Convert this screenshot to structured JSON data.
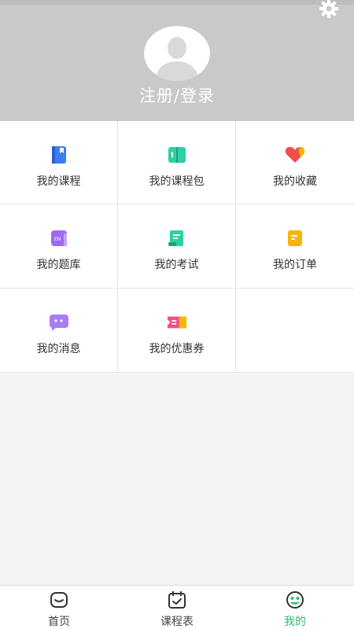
{
  "header": {
    "login_label": "注册/登录",
    "settings_icon": "gear-icon",
    "avatar_icon": "default-avatar-icon"
  },
  "menu": [
    {
      "label": "我的课程",
      "icon": "course-book-icon",
      "color": "#3d7cf5"
    },
    {
      "label": "我的课程包",
      "icon": "course-package-icon",
      "color": "#2ad1a3"
    },
    {
      "label": "我的收藏",
      "icon": "heart-favorite-icon",
      "color": "#f04d4d"
    },
    {
      "label": "我的题库",
      "icon": "question-bank-icon",
      "color": "#9b6cf0"
    },
    {
      "label": "我的考试",
      "icon": "exam-scroll-icon",
      "color": "#2ad1a3"
    },
    {
      "label": "我的订单",
      "icon": "order-note-icon",
      "color": "#f7b500"
    },
    {
      "label": "我的消息",
      "icon": "message-bubble-icon",
      "color": "#a77cf5"
    },
    {
      "label": "我的优惠券",
      "icon": "coupon-ticket-icon",
      "color": "#f0508a"
    }
  ],
  "tabbar": {
    "tabs": [
      {
        "label": "首页",
        "icon": "home-icon"
      },
      {
        "label": "课程表",
        "icon": "calendar-icon"
      },
      {
        "label": "我的",
        "icon": "profile-face-icon"
      }
    ],
    "active_color": "#2dbe73"
  }
}
